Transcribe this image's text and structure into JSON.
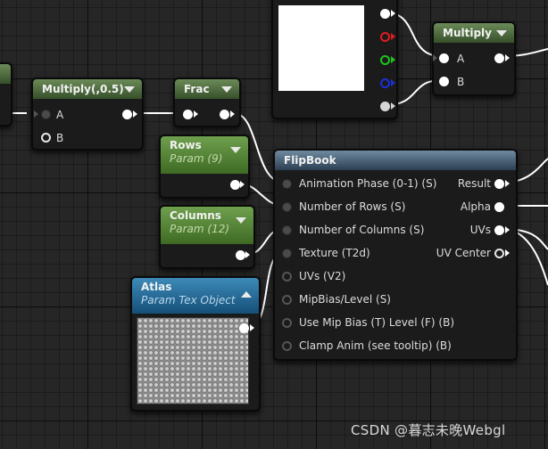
{
  "nodes": {
    "multiply_left": {
      "title": "Multiply(,0.5)",
      "inputs": [
        "A",
        "B"
      ]
    },
    "frac": {
      "title": "Frac"
    },
    "rows": {
      "title": "Rows",
      "subtitle": "Param (9)"
    },
    "columns": {
      "title": "Columns",
      "subtitle": "Param (12)"
    },
    "atlas": {
      "title": "Atlas",
      "subtitle": "Param Tex Object"
    },
    "multiply_right": {
      "title": "Multiply",
      "inputs": [
        "A",
        "B"
      ]
    },
    "flipbook": {
      "title": "FlipBook",
      "inputs": [
        "Animation  Phase (0-1) (S)",
        "Number of Rows (S)",
        "Number of Columns (S)",
        "Texture (T2d)",
        "UVs (V2)",
        "MipBias/Level (S)",
        "Use Mip Bias (T) Level (F) (B)",
        "Clamp Anim (see tooltip) (B)"
      ],
      "outputs": [
        "Result",
        "Alpha",
        "UVs",
        "UV Center"
      ]
    }
  },
  "colors": {
    "grid_background": "#262626",
    "wire": "#ffffff",
    "pin_red": "#e11c1c",
    "pin_green": "#1ec41e",
    "pin_blue": "#1b2fd6",
    "material_header": "#36502a",
    "param_header": "#3e6a23",
    "texture_header": "#154f78",
    "function_header": "#2c3f52"
  },
  "watermark": "CSDN @暮志未晚Webgl"
}
